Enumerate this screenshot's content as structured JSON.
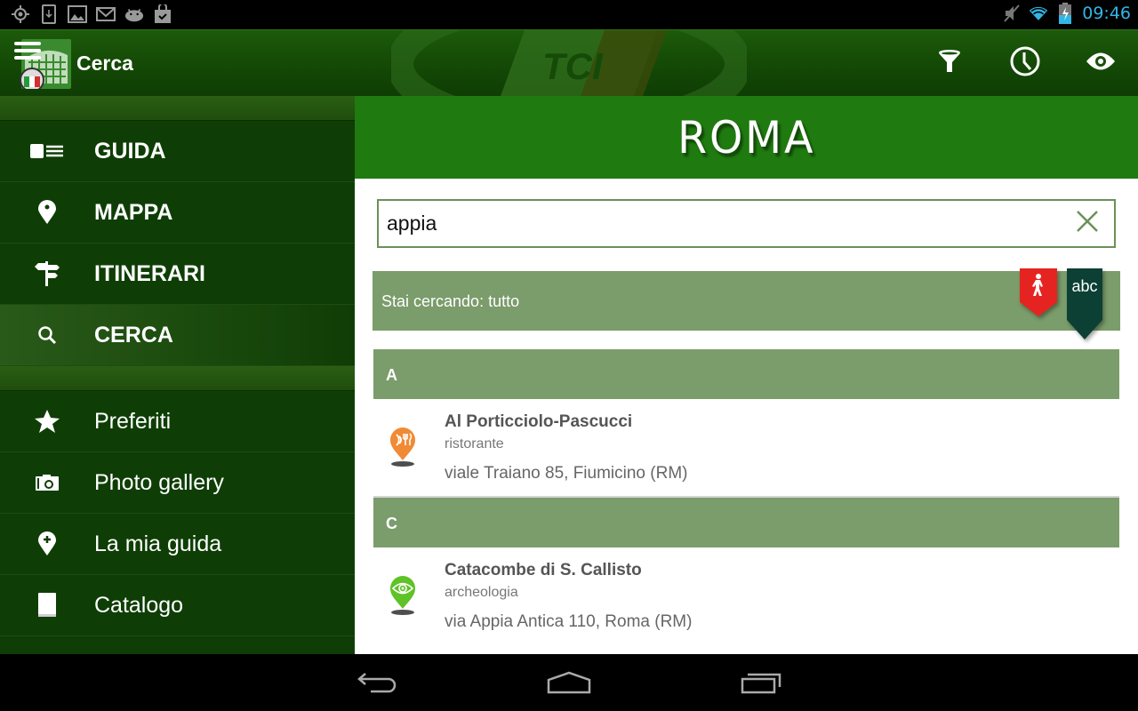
{
  "status_bar": {
    "time": "09:46",
    "left_icons": [
      "gps-icon",
      "download-icon",
      "gallery-icon",
      "gmail-icon",
      "android-icon",
      "store-icon"
    ],
    "right_icons": [
      "mute-icon",
      "wifi-icon",
      "battery-charging-icon"
    ]
  },
  "action_bar": {
    "title": "Cerca",
    "actions": [
      {
        "name": "filter",
        "icon": "filter-icon"
      },
      {
        "name": "history",
        "icon": "clock-icon"
      },
      {
        "name": "view",
        "icon": "eye-icon"
      }
    ]
  },
  "drawer": {
    "primary_items": [
      {
        "label": "GUIDA",
        "icon": "guide-icon"
      },
      {
        "label": "MAPPA",
        "icon": "map-pin-icon"
      },
      {
        "label": "ITINERARI",
        "icon": "signpost-icon"
      },
      {
        "label": "CERCA",
        "icon": "search-icon",
        "active": true
      }
    ],
    "secondary_items": [
      {
        "label": "Preferiti",
        "icon": "star-icon"
      },
      {
        "label": "Photo gallery",
        "icon": "camera-icon"
      },
      {
        "label": "La mia guida",
        "icon": "pin-plus-icon"
      },
      {
        "label": "Catalogo",
        "icon": "book-icon"
      }
    ]
  },
  "main": {
    "city": "ROMA",
    "search": {
      "value": "appia",
      "placeholder": ""
    },
    "filter_text": "Stai cercando: tutto",
    "tags": [
      {
        "name": "walk",
        "color": "#e52421"
      },
      {
        "name": "abc",
        "label": "abc",
        "color": "#0c4034"
      }
    ],
    "sections": [
      {
        "letter": "A",
        "results": [
          {
            "name": "Al Porticciolo-Pascucci",
            "category": "ristorante",
            "address": "viale Traiano 85, Fiumicino (RM)",
            "pin_color": "#f08a35",
            "pin_icon": "restaurant-icon"
          }
        ]
      },
      {
        "letter": "C",
        "results": [
          {
            "name": "Catacombe di S. Callisto",
            "category": "archeologia",
            "address": "via Appia Antica 110, Roma (RM)",
            "pin_color": "#5fc227",
            "pin_icon": "eye-icon"
          }
        ]
      }
    ]
  },
  "colors": {
    "header_green": "#1f7a10",
    "section_green": "#7b9c6b",
    "drawer_bg": "#0e3e05",
    "status_time": "#33b5e5"
  }
}
